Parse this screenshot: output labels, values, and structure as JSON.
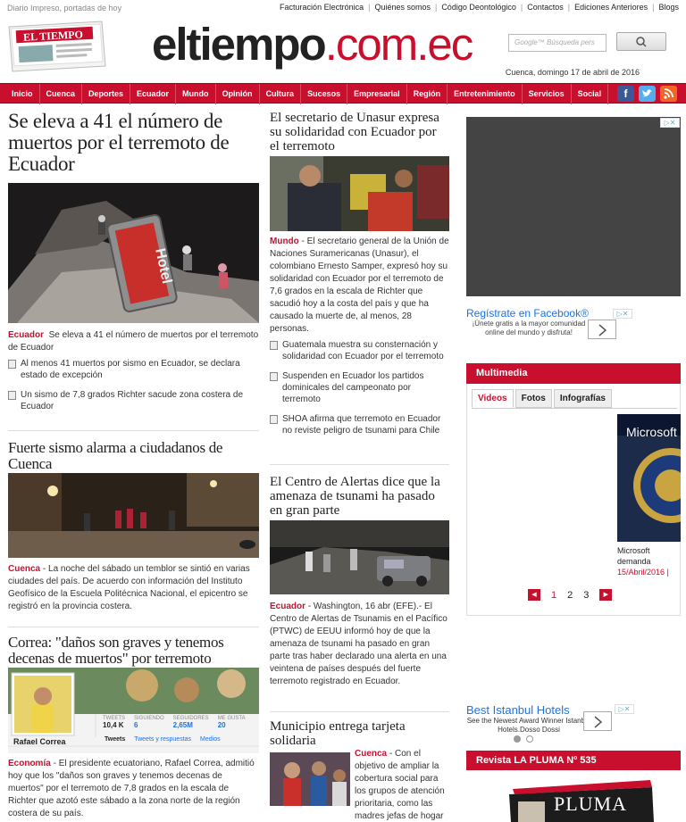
{
  "topbar": {
    "tagline": "Diario Impreso, portadas de hoy",
    "links": [
      "Facturación Electrónica",
      "Quiénes somos",
      "Código Deontológico",
      "Contactos",
      "Ediciones Anteriores",
      "Blogs"
    ]
  },
  "header": {
    "paper_logo": "EL TIEMPO",
    "brand_main": "eltiempo",
    "brand_domain": ".com.ec",
    "search_placeholder": "Búsqueda pers",
    "search_google": "Google™",
    "date": "Cuenca, domingo 17 de abril de 2016"
  },
  "nav": {
    "items": [
      "Inicio",
      "Cuenca",
      "Deportes",
      "Ecuador",
      "Mundo",
      "Opinión",
      "Cultura",
      "Sucesos",
      "Empresarial",
      "Región",
      "Entretenimiento",
      "Servicios",
      "Social"
    ],
    "social": [
      "f",
      "t",
      "rss"
    ]
  },
  "col1": {
    "lead": {
      "title": "Se eleva a 41 el número de muertos por el terremoto de Ecuador",
      "photo_sign": "Hotel",
      "category": "Ecuador",
      "summary": "Se eleva a 41 el número de muertos por el terremoto de Ecuador",
      "related": [
        "Al menos 41 muertos por sismo en Ecuador, se declara estado de excepción",
        "Un sismo de 7,8 grados Richter sacude zona costera de Ecuador"
      ]
    },
    "story2": {
      "title": "Fuerte sismo alarma a ciudadanos de Cuenca",
      "category": "Cuenca",
      "body": "La noche del sábado un temblor se sintió en varias ciudades del país. De acuerdo con información del Instituto Geofísico de la Escuela Politécnica Nacional, el epicentro se registró en la provincia costera."
    },
    "story3": {
      "title": "Correa: \"daños son graves y tenemos decenas de muertos\" por terremoto",
      "tweet_name": "Rafael Correa",
      "tweet_stats": [
        {
          "label": "TWEETS",
          "value": "10,4 K"
        },
        {
          "label": "SIGUIENDO",
          "value": "6"
        },
        {
          "label": "SEGUIDORES",
          "value": "2,65M"
        },
        {
          "label": "ME GUSTA",
          "value": "20"
        }
      ],
      "tweet_tabs": [
        "Tweets",
        "Tweets y respuestas",
        "Medios"
      ],
      "category": "Economía",
      "body": "El presidente ecuatoriano, Rafael Correa, admitió hoy que los \"daños son graves y tenemos decenas de muertos\" por el terremoto de 7,8 grados en la escala de Richter que azotó este sábado a la zona norte de la región costera de su país."
    }
  },
  "col2": {
    "story1": {
      "title": "El secretario de Unasur expresa su solidaridad con Ecuador por el terremoto",
      "category": "Mundo",
      "body": "El secretario general de la Unión de Naciones Suramericanas (Unasur), el colombiano Ernesto Samper, expresó hoy su solidaridad con Ecuador por el terremoto de 7,6 grados en la escala de Richter que sacudió hoy a la costa del país y que ha causado la muerte de, al menos, 28 personas.",
      "related": [
        "Guatemala muestra su consternación y solidaridad con Ecuador por el terremoto",
        "Suspenden en Ecuador los partidos dominicales del campeonato por terremoto",
        "SHOA afirma que terremoto en Ecuador no reviste peligro de tsunami para Chile"
      ]
    },
    "story2": {
      "title": "El Centro de Alertas dice que la amenaza de tsunami ha pasado en gran parte",
      "category": "Ecuador",
      "body": "Washington, 16 abr (EFE).- El Centro de Alertas de Tsunamis en el Pacífico (PTWC) de EEUU informó hoy de que la amenaza de tsunami ha pasado en gran parte tras haber declarado una alerta en una veintena de países después del fuerte terremoto registrado en Ecuador."
    },
    "story3": {
      "title": "Municipio entrega tarjeta solidaria",
      "category": "Cuenca",
      "body": "Con el objetivo de ampliar la cobertura social para los grupos de atención prioritaria, como las madres jefas de hogar y"
    }
  },
  "col3": {
    "fb_ad": {
      "title": "Regístrate en Facebook®",
      "text": "¡Únete gratis a la mayor comunidad online del mundo y disfruta!"
    },
    "multimedia": {
      "title": "Multimedia",
      "tabs": [
        "Videos",
        "Fotos",
        "Infografías"
      ],
      "video_label": "Microsoft",
      "caption": "Microsoft demanda búsquedas secreta",
      "caption_date": "15/Abril/2016 |",
      "pages": [
        "1",
        "2",
        "3"
      ]
    },
    "hotel_ad": {
      "title": "Best Istanbul Hotels",
      "text": "See the Newest Award Winner Istanbul Hotels.Dosso Dossi"
    },
    "pluma": {
      "title": "Revista LA PLUMA Nº 535",
      "cover": "PLUMA"
    }
  },
  "colors": {
    "brand_red": "#c8102e",
    "link_blue": "#1a73e8"
  }
}
